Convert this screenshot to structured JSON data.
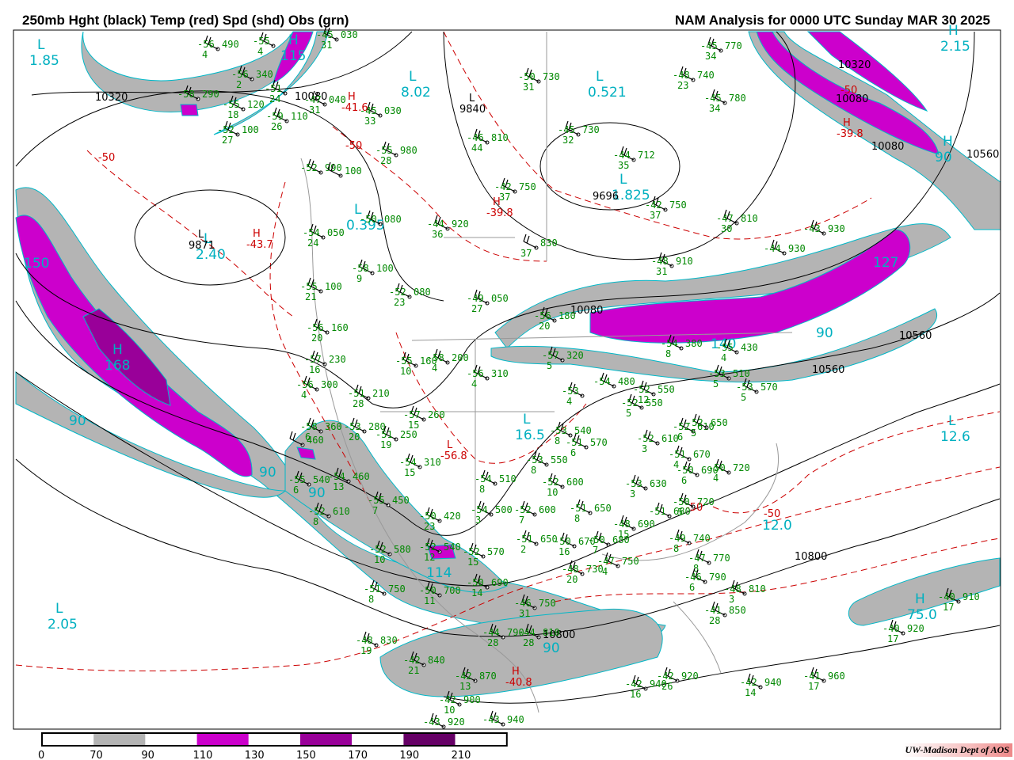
{
  "title_left": "250mb Hght (black) Temp (red) Spd (shd) Obs (grn)",
  "title_right": "NAM Analysis for 0000 UTC Sunday  MAR 30 2025",
  "credit": "UW-Madison  Dept of AOS",
  "legend": {
    "labels": [
      "0",
      "70",
      "90",
      "110",
      "130",
      "150",
      "170",
      "190",
      "210"
    ],
    "bins": [
      {
        "range": "0-70",
        "color": "#ffffff"
      },
      {
        "range": "70-90",
        "color": "#b4b4b4"
      },
      {
        "range": "90-110",
        "color": "#ffffff"
      },
      {
        "range": "110-130",
        "color": "#cc00cc"
      },
      {
        "range": "130-150",
        "color": "#ffffff"
      },
      {
        "range": "150-170",
        "color": "#990099"
      },
      {
        "range": "170-190",
        "color": "#ffffff"
      },
      {
        "range": "190-210",
        "color": "#660066"
      },
      {
        "range": ">210",
        "color": "#ffffff"
      }
    ]
  },
  "speed_labels": [
    {
      "sym": "L",
      "val": "1.85"
    },
    {
      "sym": "L",
      "val": "8.02"
    },
    {
      "sym": "L",
      "val": "0.521"
    },
    {
      "sym": "H",
      "val": "2.15"
    },
    {
      "sym": "L",
      "val": "0.395"
    },
    {
      "sym": "L",
      "val": "2.40"
    },
    {
      "sym": "H",
      "val": "168"
    },
    {
      "sym": "",
      "val": "150"
    },
    {
      "sym": "",
      "val": "90"
    },
    {
      "sym": "L",
      "val": "16.5"
    },
    {
      "sym": "L",
      "val": "12.6"
    },
    {
      "sym": "",
      "val": "12.0"
    },
    {
      "sym": "L",
      "val": "2.05"
    },
    {
      "sym": "H",
      "val": "75.0"
    },
    {
      "sym": "",
      "val": "90"
    },
    {
      "sym": "",
      "val": "90"
    },
    {
      "sym": "",
      "val": "114"
    },
    {
      "sym": "",
      "val": "90"
    },
    {
      "sym": "",
      "val": "127"
    },
    {
      "sym": "",
      "val": "140"
    },
    {
      "sym": "",
      "val": "90"
    },
    {
      "sym": "H",
      "val": "90"
    },
    {
      "sym": "L",
      "val": "1.825"
    },
    {
      "sym": "H",
      "val": "115"
    }
  ],
  "temp_labels": [
    {
      "sym": "H",
      "val": "-41.6"
    },
    {
      "sym": "",
      "val": "-50"
    },
    {
      "sym": "",
      "val": "-50"
    },
    {
      "sym": "H",
      "val": "-43.7"
    },
    {
      "sym": "H",
      "val": "-39.8"
    },
    {
      "sym": "L",
      "val": "-56.8"
    },
    {
      "sym": "H",
      "val": "-40.8"
    },
    {
      "sym": "H",
      "val": "-39.8"
    },
    {
      "sym": "",
      "val": "-50"
    },
    {
      "sym": "",
      "val": "-50"
    },
    {
      "sym": "",
      "val": "-50"
    }
  ],
  "height_labels": [
    {
      "sym": "",
      "val": "10320"
    },
    {
      "sym": "",
      "val": "10080"
    },
    {
      "sym": "L",
      "val": "9840"
    },
    {
      "sym": "",
      "val": "9696"
    },
    {
      "sym": "L",
      "val": "9871"
    },
    {
      "sym": "",
      "val": "10320"
    },
    {
      "sym": "",
      "val": "10080"
    },
    {
      "sym": "",
      "val": "10080"
    },
    {
      "sym": "",
      "val": "10560"
    },
    {
      "sym": "",
      "val": "10080"
    },
    {
      "sym": "",
      "val": "10560"
    },
    {
      "sym": "",
      "val": "10560"
    },
    {
      "sym": "",
      "val": "10800"
    },
    {
      "sym": "",
      "val": "10800"
    }
  ],
  "obs": [
    {
      "t": "-56",
      "h": "490",
      "d": "4"
    },
    {
      "t": "-55",
      "h": "",
      "d": "4"
    },
    {
      "t": "-56",
      "h": "340",
      "d": "2"
    },
    {
      "t": "-45",
      "h": "030",
      "d": "31"
    },
    {
      "t": "-58",
      "h": "290",
      "d": ""
    },
    {
      "t": "-51",
      "h": "",
      "d": "24"
    },
    {
      "t": "-47",
      "h": "040",
      "d": "31"
    },
    {
      "t": "-55",
      "h": "120",
      "d": "18"
    },
    {
      "t": "-59",
      "h": "110",
      "d": "26"
    },
    {
      "t": "-52",
      "h": "100",
      "d": "27"
    },
    {
      "t": "-45",
      "h": "030",
      "d": "33"
    },
    {
      "t": "-55",
      "h": "980",
      "d": "28"
    },
    {
      "t": "-52",
      "h": "990",
      "d": ""
    },
    {
      "t": "",
      "h": "100",
      "d": ""
    },
    {
      "t": "-46",
      "h": "810",
      "d": "44"
    },
    {
      "t": "-45",
      "h": "730",
      "d": "32"
    },
    {
      "t": "-44",
      "h": "712",
      "d": "35"
    },
    {
      "t": "-42",
      "h": "750",
      "d": "37"
    },
    {
      "t": "-50",
      "h": "730",
      "d": "31"
    },
    {
      "t": "-48",
      "h": "740",
      "d": "23"
    },
    {
      "t": "-45",
      "h": "770",
      "d": "34"
    },
    {
      "t": "-45",
      "h": "780",
      "d": "34"
    },
    {
      "t": "-44",
      "h": "920",
      "d": "36"
    },
    {
      "t": "-50",
      "h": "080",
      "d": ""
    },
    {
      "t": "-54",
      "h": "050",
      "d": "24"
    },
    {
      "t": "-58",
      "h": "100",
      "d": "9"
    },
    {
      "t": "-55",
      "h": "100",
      "d": "21"
    },
    {
      "t": "-52",
      "h": "080",
      "d": "23"
    },
    {
      "t": "-49",
      "h": "050",
      "d": "27"
    },
    {
      "t": "",
      "h": "830",
      "d": "37"
    },
    {
      "t": "-42",
      "h": "750",
      "d": "37"
    },
    {
      "t": "-47",
      "h": "810",
      "d": "30"
    },
    {
      "t": "-44",
      "h": "930",
      "d": ""
    },
    {
      "t": "-43",
      "h": "930",
      "d": ""
    },
    {
      "t": "-48",
      "h": "910",
      "d": "31"
    },
    {
      "t": "-56",
      "h": "160",
      "d": "20"
    },
    {
      "t": "-57",
      "h": "230",
      "d": "16"
    },
    {
      "t": "-56",
      "h": "300",
      "d": "4"
    },
    {
      "t": "-51",
      "h": "210",
      "d": "28"
    },
    {
      "t": "-55",
      "h": "160",
      "d": "10"
    },
    {
      "t": "-58",
      "h": "200",
      "d": "4"
    },
    {
      "t": "-56",
      "h": "310",
      "d": "4"
    },
    {
      "t": "-57",
      "h": "260",
      "d": "15"
    },
    {
      "t": "-53",
      "h": "280",
      "d": "20"
    },
    {
      "t": "-58",
      "h": "360",
      "d": "6"
    },
    {
      "t": "",
      "h": "460",
      "d": ""
    },
    {
      "t": "-51",
      "h": "250",
      "d": "19"
    },
    {
      "t": "-54",
      "h": "310",
      "d": "15"
    },
    {
      "t": "-57",
      "h": "320",
      "d": "5"
    },
    {
      "t": "-56",
      "h": "180",
      "d": "20"
    },
    {
      "t": "-54",
      "h": "380",
      "d": "8"
    },
    {
      "t": "-55",
      "h": "430",
      "d": "4"
    },
    {
      "t": "-53",
      "h": "510",
      "d": "5"
    },
    {
      "t": "-54",
      "h": "480",
      "d": ""
    },
    {
      "t": "-53",
      "h": "",
      "d": "4"
    },
    {
      "t": "-52",
      "h": "550",
      "d": "12"
    },
    {
      "t": "-52",
      "h": "550",
      "d": "5"
    },
    {
      "t": "-53",
      "h": "570",
      "d": "5"
    },
    {
      "t": "-53",
      "h": "540",
      "d": "8"
    },
    {
      "t": "-51",
      "h": "570",
      "d": "6"
    },
    {
      "t": "-52",
      "h": "610",
      "d": "3"
    },
    {
      "t": "-52",
      "h": "610",
      "d": "6"
    },
    {
      "t": "-52",
      "h": "650",
      "d": "5"
    },
    {
      "t": "-51",
      "h": "670",
      "d": "4"
    },
    {
      "t": "-50",
      "h": "690",
      "d": "6"
    },
    {
      "t": "-50",
      "h": "720",
      "d": "4"
    },
    {
      "t": "-54",
      "h": "510",
      "d": "8"
    },
    {
      "t": "-52",
      "h": "600",
      "d": "10"
    },
    {
      "t": "-53",
      "h": "550",
      "d": "8"
    },
    {
      "t": "-53",
      "h": "630",
      "d": "3"
    },
    {
      "t": "-54",
      "h": "460",
      "d": "13"
    },
    {
      "t": "-55",
      "h": "540",
      "d": "6"
    },
    {
      "t": "-55",
      "h": "450",
      "d": "7"
    },
    {
      "t": "-52",
      "h": "610",
      "d": "8"
    },
    {
      "t": "-50",
      "h": "420",
      "d": "23"
    },
    {
      "t": "-54",
      "h": "500",
      "d": "3"
    },
    {
      "t": "-52",
      "h": "600",
      "d": "7"
    },
    {
      "t": "-51",
      "h": "650",
      "d": "8"
    },
    {
      "t": "-50",
      "h": "720",
      "d": "5"
    },
    {
      "t": "-48",
      "h": "690",
      "d": "15"
    },
    {
      "t": "-51",
      "h": "680",
      "d": ""
    },
    {
      "t": "-52",
      "h": "580",
      "d": "10"
    },
    {
      "t": "-52",
      "h": "540",
      "d": "12"
    },
    {
      "t": "-52",
      "h": "570",
      "d": "15"
    },
    {
      "t": "-51",
      "h": "650",
      "d": "2"
    },
    {
      "t": "-50",
      "h": "670",
      "d": "16"
    },
    {
      "t": "-50",
      "h": "680",
      "d": "7"
    },
    {
      "t": "-49",
      "h": "740",
      "d": "8"
    },
    {
      "t": "-48",
      "h": "730",
      "d": "20"
    },
    {
      "t": "-47",
      "h": "750",
      "d": "4"
    },
    {
      "t": "-47",
      "h": "770",
      "d": "8"
    },
    {
      "t": "-46",
      "h": "790",
      "d": "6"
    },
    {
      "t": "-48",
      "h": "810",
      "d": "3"
    },
    {
      "t": "-51",
      "h": "750",
      "d": "8"
    },
    {
      "t": "-50",
      "h": "700",
      "d": "11"
    },
    {
      "t": "-50",
      "h": "690",
      "d": "14"
    },
    {
      "t": "-46",
      "h": "750",
      "d": "31"
    },
    {
      "t": "-44",
      "h": "790",
      "d": "28"
    },
    {
      "t": "-44",
      "h": "810",
      "d": "28"
    },
    {
      "t": "-41",
      "h": "850",
      "d": "28"
    },
    {
      "t": "-48",
      "h": "830",
      "d": "19"
    },
    {
      "t": "-42",
      "h": "840",
      "d": "21"
    },
    {
      "t": "-42",
      "h": "870",
      "d": "13"
    },
    {
      "t": "-42",
      "h": "900",
      "d": "10"
    },
    {
      "t": "-43",
      "h": "940",
      "d": ""
    },
    {
      "t": "-43",
      "h": "920",
      "d": ""
    },
    {
      "t": "-42",
      "h": "920",
      "d": "26"
    },
    {
      "t": "-42",
      "h": "940",
      "d": "16"
    },
    {
      "t": "-42",
      "h": "940",
      "d": "14"
    },
    {
      "t": "-41",
      "h": "960",
      "d": "17"
    },
    {
      "t": "-40",
      "h": "920",
      "d": "17"
    },
    {
      "t": "-40",
      "h": "910",
      "d": "17"
    }
  ]
}
